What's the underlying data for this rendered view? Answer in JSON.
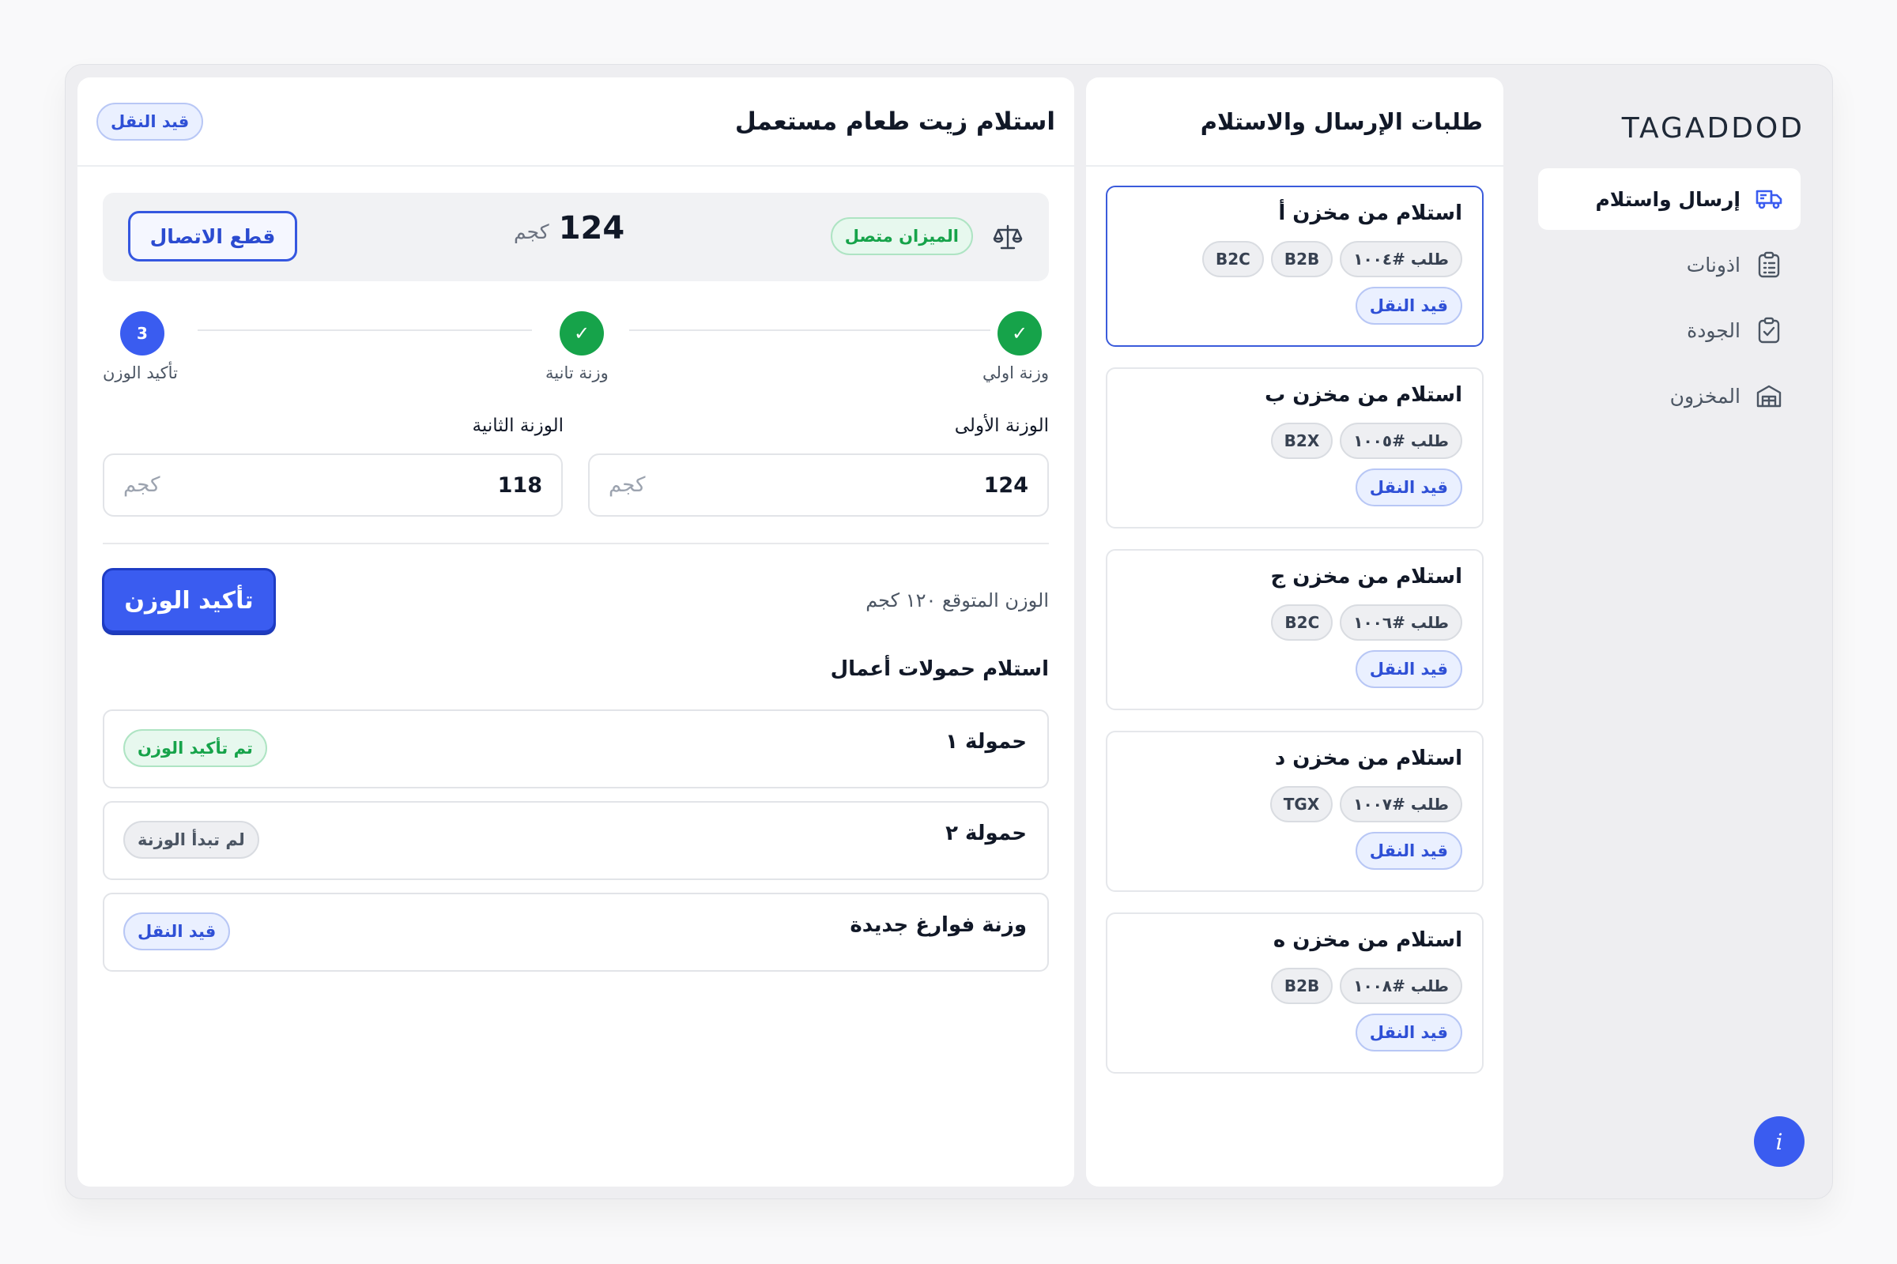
{
  "sidebar": {
    "logo": "TAGADDOD",
    "items": [
      {
        "label": "إرسال واستلام",
        "icon": "truck-icon",
        "active": true
      },
      {
        "label": "اذونات",
        "icon": "clipboard-list-icon",
        "active": false
      },
      {
        "label": "الجودة",
        "icon": "clipboard-check-icon",
        "active": false
      },
      {
        "label": "المخزون",
        "icon": "warehouse-icon",
        "active": false
      }
    ],
    "info_label": "i"
  },
  "requests": {
    "title": "طلبات الإرسال والاستلام",
    "cards": [
      {
        "title": "استلام من مخزن أ",
        "order": "طلب #١٠٠٤",
        "tags": [
          "B2B",
          "B2C"
        ],
        "status": "قيد النقل",
        "selected": true
      },
      {
        "title": "استلام من مخزن ب",
        "order": "طلب #١٠٠٥",
        "tags": [
          "B2X"
        ],
        "status": "قيد النقل",
        "selected": false
      },
      {
        "title": "استلام من مخزن ج",
        "order": "طلب #١٠٠٦",
        "tags": [
          "B2C"
        ],
        "status": "قيد النقل",
        "selected": false
      },
      {
        "title": "استلام من مخزن د",
        "order": "طلب #١٠٠٧",
        "tags": [
          "TGX"
        ],
        "status": "قيد النقل",
        "selected": false
      },
      {
        "title": "استلام من مخزن ه",
        "order": "طلب #١٠٠٨",
        "tags": [
          "B2B"
        ],
        "status": "قيد النقل",
        "selected": false
      }
    ]
  },
  "main": {
    "title": "استلام زيت طعام مستعمل",
    "status": "قيد النقل",
    "scale": {
      "status": "الميزان متصل",
      "reading": "124",
      "unit": "كجم",
      "disconnect_label": "قطع الاتصال"
    },
    "steps": [
      {
        "label": "وزنة اولي",
        "state": "done",
        "mark": "✓"
      },
      {
        "label": "وزنة تانية",
        "state": "done",
        "mark": "✓"
      },
      {
        "label": "تأكيد الوزن",
        "state": "current",
        "mark": "3"
      }
    ],
    "first_weight": {
      "label": "الوزنة الأولى",
      "value": "124",
      "unit": "كجم"
    },
    "second_weight": {
      "label": "الوزنة الثانية",
      "value": "118",
      "unit": "كجم"
    },
    "expected_weight": "الوزن المتوقع ١٢٠ كجم",
    "confirm_label": "تأكيد الوزن",
    "loads_title": "استلام حمولات أعمال",
    "loads": [
      {
        "name": "حمولة ١",
        "status": "تم تأكيد الوزن",
        "kind": "confirmed"
      },
      {
        "name": "حمولة ٢",
        "status": "لم تبدأ الوزنة",
        "kind": "not-started"
      },
      {
        "name": "وزنة فوارغ جديدة",
        "status": "قيد النقل",
        "kind": "transit"
      }
    ]
  },
  "colors": {
    "accent": "#3a5cf0",
    "success": "#16a34a",
    "transit_bg": "#eaf0ff"
  }
}
